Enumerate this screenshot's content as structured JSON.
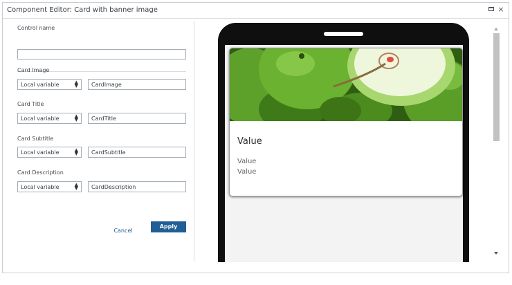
{
  "window": {
    "title": "Component Editor: Card with banner image",
    "maximize_icon": "maximize-icon",
    "close_icon": "close-icon",
    "close_glyph": "×"
  },
  "form": {
    "control_name": {
      "label": "Control name",
      "value": ""
    },
    "fields": [
      {
        "label": "Card Image",
        "source": "Local variable",
        "value": "CardImage"
      },
      {
        "label": "Card Title",
        "source": "Local variable",
        "value": "CardTitle"
      },
      {
        "label": "Card Subtitle",
        "source": "Local variable",
        "value": "CardSubtitle"
      },
      {
        "label": "Card Description",
        "source": "Local variable",
        "value": "CardDescription"
      }
    ],
    "cancel_label": "Cancel",
    "apply_label": "Apply"
  },
  "preview": {
    "banner_image": "green-apples-image",
    "card_title": "Value",
    "card_subtitle": "Value",
    "card_description": "Value"
  },
  "colors": {
    "apply_button": "#1f5f94",
    "cancel_link": "#1d5b97",
    "phone_frame": "#0f0f0f"
  }
}
